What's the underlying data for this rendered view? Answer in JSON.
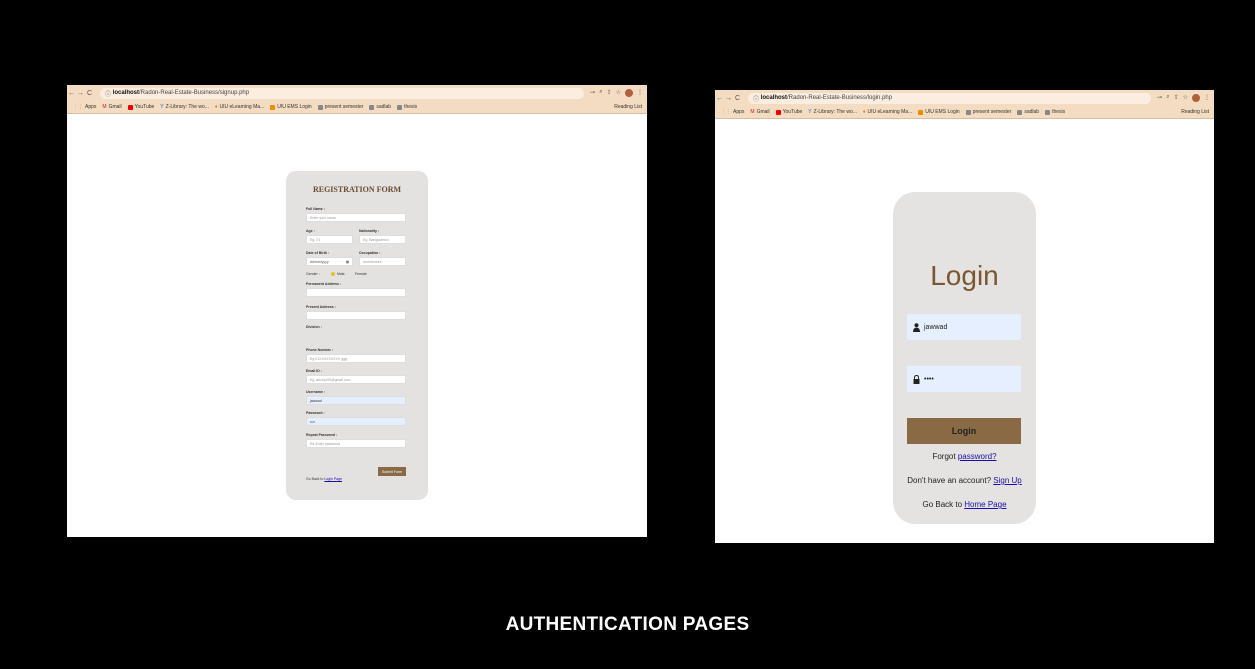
{
  "left_window": {
    "url_host": "localhost",
    "url_path": "/Radon-Real-Estate-Business/signup.php",
    "bookmarks": [
      "Apps",
      "Gmail",
      "YouTube",
      "Z-Library: The wo...",
      "UIU eLearning Ma...",
      "UIU EMS Login",
      "present semester",
      "sadlab",
      "thesis"
    ],
    "reading_list": "Reading List",
    "form": {
      "title": "REGISTRATION FORM",
      "full_name_label": "Full Name :",
      "full_name_placeholder": "Enter your name",
      "age_label": "Age :",
      "age_placeholder": "Eg. 21",
      "nationality_label": "Nationality :",
      "nationality_placeholder": "Eg. Bangladeshi",
      "dob_label": "Date of Birth :",
      "dob_value": "dd/mm/yyyy",
      "occupation_label": "Occupation :",
      "occupation_placeholder": "Architecture",
      "gender_label": "Gender :",
      "gender_male": "Male",
      "gender_female": "Female",
      "permanent_label": "Permanent Address :",
      "present_label": "Present Address :",
      "division_label": "Division :",
      "phone_label": "Phone Number :",
      "phone_placeholder": "Eg.01XXXXXXXXX ggg",
      "email_label": "Email ID :",
      "email_placeholder": "Eg. abcxyz99@gmail.com",
      "username_label": "Username :",
      "username_value": "jawwad",
      "password_label": "Password :",
      "password_value": "••••",
      "repeat_label": "Repeat Password :",
      "repeat_placeholder": "Re-Enter password",
      "submit_label": "Submit Form",
      "goback_prefix": "Go Back to",
      "goback_link": "Login Page"
    }
  },
  "right_window": {
    "url_host": "localhost",
    "url_path": "/Radon-Real-Estate-Business/login.php",
    "bookmarks": [
      "Apps",
      "Gmail",
      "YouTube",
      "Z-Library: The wo...",
      "UIU eLearning Ma...",
      "UIU EMS Login",
      "present semester",
      "sadlab",
      "thesis"
    ],
    "reading_list": "Reading List",
    "login": {
      "title": "Login",
      "username_value": "jawwad",
      "password_value": "••••",
      "button_label": "Login",
      "forgot_prefix": "Forgot",
      "forgot_link": "password?",
      "signup_prefix": "Don't have an account?",
      "signup_link": "Sign Up",
      "home_prefix": "Go Back to",
      "home_link": "Home Page"
    }
  },
  "caption": "AUTHENTICATION PAGES",
  "colors": {
    "background": "#000000",
    "chrome": "#f3dcc1",
    "brand_brown": "#8a6a44",
    "card": "#e4e1e1",
    "link": "#1a0dab"
  }
}
